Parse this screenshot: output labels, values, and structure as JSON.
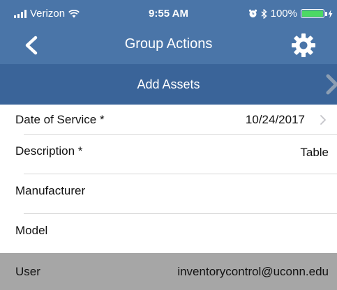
{
  "status_bar": {
    "carrier": "Verizon",
    "time": "9:55 AM",
    "battery": "100%",
    "battery_level": 1.0,
    "battery_color": "#4cd964"
  },
  "nav": {
    "title": "Group Actions",
    "back_icon": "chevron-left-icon",
    "settings_icon": "gear-icon"
  },
  "subheader": {
    "title": "Add Assets",
    "chevron_icon": "chevron-right-icon"
  },
  "form": {
    "date_of_service": {
      "label": "Date of Service *",
      "value": "10/24/2017"
    },
    "description": {
      "label": "Description *",
      "value": "Table"
    },
    "manufacturer": {
      "label": "Manufacturer",
      "value": ""
    },
    "model": {
      "label": "Model",
      "value": ""
    },
    "user": {
      "label": "User",
      "value": "inventorycontrol@uconn.edu"
    }
  },
  "colors": {
    "nav_background": "#4a75a8",
    "subheader_background": "#3a6499",
    "disabled_row_background": "#a6a6a6"
  }
}
